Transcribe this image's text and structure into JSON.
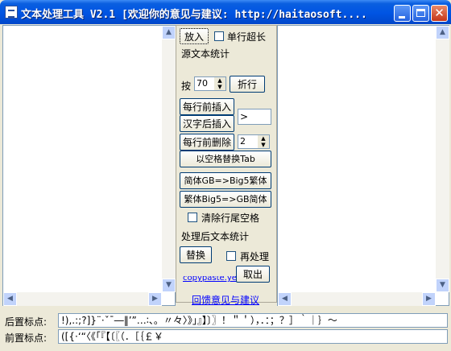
{
  "window": {
    "title": "文本处理工具 V2.1 [欢迎你的意见与建议:  http://haitaosoft...."
  },
  "panel": {
    "fangru_label": "放入",
    "line_overlength_label": "单行超长",
    "source_stats_label": "源文本统计",
    "an_label": "按",
    "wrap_value": "70",
    "wrap_button": "折行",
    "insert_before_line": "每行前插入",
    "insert_after_hanzi": "汉字后插入",
    "insert_text": ">",
    "delete_before_line": "每行前删除",
    "delete_count": "2",
    "space_to_tab": "以空格替换Tab",
    "gb_to_big5": "简体GB=>Big5繁体",
    "big5_to_gb": "繁体Big5=>GB简体",
    "trim_trailing": "清除行尾空格",
    "processed_stats_label": "处理后文本统计",
    "replace_button": "替换",
    "reprocess_label": "再处理",
    "cancel_button": "取出",
    "partial_link": "copypaste.yeah.net",
    "feedback_link": "回馈意见与建议"
  },
  "bottom": {
    "post_punct_label": "后置标点:",
    "post_punct_value": "!),.:;?]}¨·ˇˉ―‖’”…∶、。〃々〉》」』】〕〗！＂＇），．：；？］｀｜｝～",
    "pre_punct_label": "前置标点:",
    "pre_punct_value": "([{·‘“〈《「『【〔〖（．［｛￡￥"
  },
  "icons": {
    "app": "app-icon",
    "minimize": "minimize-icon",
    "maximize": "maximize-icon",
    "close": "close-icon"
  }
}
